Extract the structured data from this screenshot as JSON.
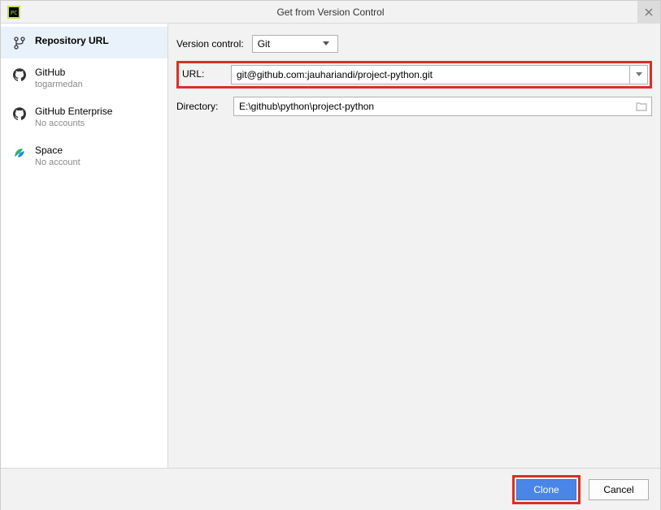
{
  "titlebar": {
    "title": "Get from Version Control"
  },
  "sidebar": {
    "items": [
      {
        "label": "Repository URL",
        "sublabel": "",
        "selected": true
      },
      {
        "label": "GitHub",
        "sublabel": "togarmedan",
        "selected": false
      },
      {
        "label": "GitHub Enterprise",
        "sublabel": "No accounts",
        "selected": false
      },
      {
        "label": "Space",
        "sublabel": "No account",
        "selected": false
      }
    ]
  },
  "form": {
    "vc_label": "Version control:",
    "vc_value": "Git",
    "url_label": "URL:",
    "url_value": "git@github.com:jauhariandi/project-python.git",
    "dir_label": "Directory:",
    "dir_value": "E:\\github\\python\\project-python"
  },
  "footer": {
    "clone_label": "Clone",
    "cancel_label": "Cancel"
  }
}
